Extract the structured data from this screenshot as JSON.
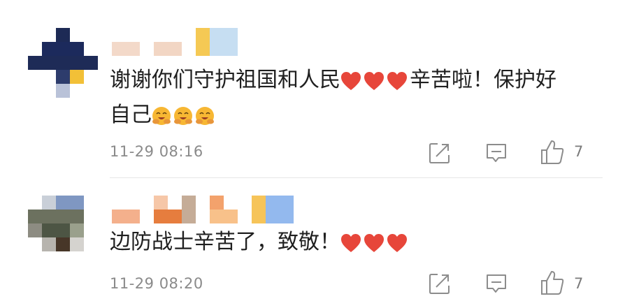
{
  "comments": [
    {
      "text_before": "谢谢你们守护祖国和人民",
      "text_middle": "辛苦啦！保护好",
      "text_line2": "自己",
      "timestamp": "11-29 08:16",
      "like_count": "7",
      "icons": [
        "share-icon",
        "reply-icon",
        "like-icon"
      ]
    },
    {
      "text_before": "边防战士辛苦了，致敬！",
      "timestamp": "11-29 08:20",
      "like_count": "7",
      "icons": [
        "share-icon",
        "reply-icon",
        "like-icon"
      ]
    }
  ],
  "colors": {
    "heart": "#e7463a",
    "face": "#f7b733",
    "meta_text": "#8a8a8a",
    "icon_stroke": "#8c8c8c"
  }
}
